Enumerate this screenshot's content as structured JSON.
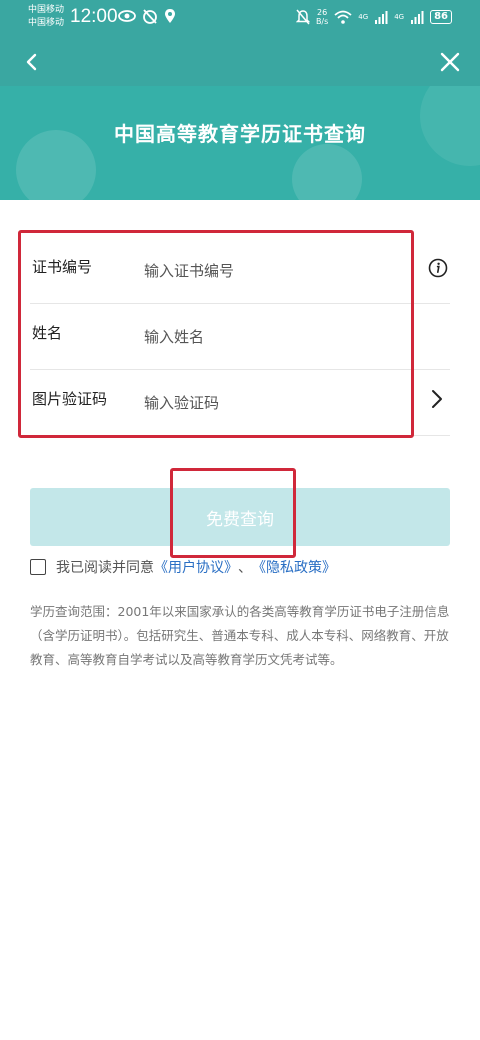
{
  "status_bar": {
    "carrier_1": "中国移动",
    "carrier_2": "中国移动",
    "time": "12:00",
    "net_speed_value": "26",
    "net_speed_unit": "B/s",
    "signal_1_label": "4G",
    "signal_2_label": "4G",
    "battery": "86",
    "icons": [
      "eye-icon",
      "alarm-off-icon",
      "location-icon",
      "mute-icon",
      "wifi-icon",
      "signal-icon",
      "battery-icon"
    ]
  },
  "nav": {
    "back_icon": "chevron-left-icon",
    "close_icon": "close-icon"
  },
  "header": {
    "title": "中国高等教育学历证书查询"
  },
  "form": {
    "fields": [
      {
        "label": "证书编号",
        "placeholder": "输入证书编号",
        "trailing_icon": "info-icon"
      },
      {
        "label": "姓名",
        "placeholder": "输入姓名"
      },
      {
        "label": "图片验证码",
        "placeholder": "输入验证码",
        "trailing_icon": "chevron-right-icon"
      }
    ]
  },
  "submit": {
    "label": "免费查询"
  },
  "agreement": {
    "checked": false,
    "text": "我已阅读并同意",
    "user_agreement": "《用户协议》",
    "separator": "、",
    "privacy_policy": "《隐私政策》"
  },
  "description": "学历查询范围：2001年以来国家承认的各类高等教育学历证书电子注册信息（含学历证明书）。包括研究生、普通本专科、成人本专科、网络教育、开放教育、高等教育自学考试以及高等教育学历文凭考试等。",
  "colors": {
    "header_teal": "#3aa7a1",
    "banner_teal": "#36b0a8",
    "button_disabled": "#c3e7e9",
    "highlight_red": "#d0283a",
    "link_blue": "#2a6fc4"
  }
}
